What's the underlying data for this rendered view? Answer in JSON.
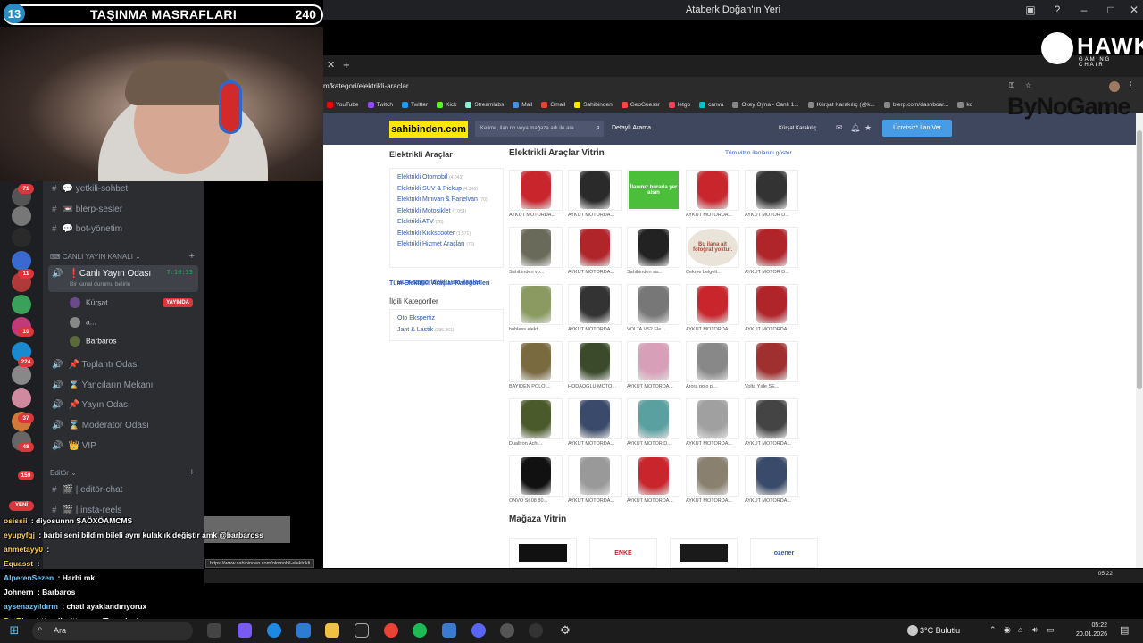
{
  "stream": {
    "left_count": "13",
    "title": "TAŞINMA MASRAFLARI",
    "right_count": "240"
  },
  "window": {
    "title": "Ataberk Doğan'ın Yeri"
  },
  "browser": {
    "url": "m/kategori/elektrikli-araclar",
    "bookmarks": [
      "YouTube",
      "Twitch",
      "Twitter",
      "Kick",
      "Streamlabs",
      "Mail",
      "Gmail",
      "Sahibinden",
      "GeoGuessr",
      "letgo",
      "canva",
      "Okey Oyna - Canlı 1...",
      "Kürşat Karakılıç (@k...",
      "blerp.com/dashboar...",
      "ko"
    ],
    "hover_link": "https://www.sahibinden.com/otomobil-elektrikli"
  },
  "overlay": {
    "hawk": "HAWK",
    "hawk_sub": "GAMING CHAIR",
    "bynogame": "ByNoGame"
  },
  "site": {
    "logo": "sahibinden.com",
    "search_placeholder": "Kelime, ilan no veya mağaza adı ile ara",
    "detailed_search": "Detaylı Arama",
    "user": "Kürşat Karakılıç",
    "post_ad": "Ücretsiz* İlan Ver",
    "left_title": "Elektrikli Araçlar",
    "categories": [
      {
        "name": "Elektrikli Otomobil",
        "count": "(4.043)"
      },
      {
        "name": "Elektrikli SUV & Pickup",
        "count": "(4.346)"
      },
      {
        "name": "Elektrikli Minivan & Panelvan",
        "count": "(70)"
      },
      {
        "name": "Elektrikli Motosiklet",
        "count": "(7.054)"
      },
      {
        "name": "Elektrikli ATV",
        "count": "(26)"
      },
      {
        "name": "Elektrikli Kickscooter",
        "count": "(1.571)"
      },
      {
        "name": "Elektrikli Hizmet Araçları",
        "count": "(76)"
      }
    ],
    "all_in_category": "Bu Kategorideki Tüm İlanlar",
    "all_categories": "Tüm Elektrikli Araçlar Kategorileri",
    "related_title": "İlgili Kategoriler",
    "related": [
      {
        "name": "Oto Ekspertiz",
        "count": ""
      },
      {
        "name": "Jant & Lastik",
        "count": "(395.361)"
      }
    ],
    "vitrin_title": "Elektrikli Araçlar Vitrin",
    "vitrin_all": "Tüm vitrin ilanlarını göster",
    "listings": [
      {
        "caption": "AYKUT MOTORDA...",
        "color": "#c8262c"
      },
      {
        "caption": "AYKUT MOTORDA...",
        "color": "#2a2a2a"
      },
      {
        "caption": "",
        "color": "#4bbf3a",
        "text": "İlanınız burada yer alsın"
      },
      {
        "caption": "AYKUT MOTORDA...",
        "color": "#c8262c"
      },
      {
        "caption": "AYKUT MOTOR D...",
        "color": "#333"
      },
      {
        "caption": "Sahibinden vo...",
        "color": "#6a6a5a"
      },
      {
        "caption": "AYKUT MOTORDA...",
        "color": "#b0252a"
      },
      {
        "caption": "Sahibinden sa...",
        "color": "#222"
      },
      {
        "caption": "Çekme belgeli...",
        "color": "#e9e3d9",
        "text": "Bu ilana ait fotoğraf yoktur."
      },
      {
        "caption": "AYKUT MOTOR D...",
        "color": "#b0252a"
      },
      {
        "caption": "hubless elekt...",
        "color": "#8a9a60"
      },
      {
        "caption": "AYKUT MOTORDA...",
        "color": "#333"
      },
      {
        "caption": "VOLTA VS2 Ele...",
        "color": "#777"
      },
      {
        "caption": "AYKUT MOTORDA...",
        "color": "#c8262c"
      },
      {
        "caption": "AYKUT MOTORDA...",
        "color": "#b0252a"
      },
      {
        "caption": "BAYİDEN POLO ...",
        "color": "#7a6a40"
      },
      {
        "caption": "HODAOĞLU MOTO...",
        "color": "#3a4a2a"
      },
      {
        "caption": "AYKUT MOTORDA...",
        "color": "#d8a0b8"
      },
      {
        "caption": "Arora polo pl...",
        "color": "#888"
      },
      {
        "caption": "Volta Yıde SE...",
        "color": "#a03030"
      },
      {
        "caption": "Dualtron Achi...",
        "color": "#4a5a2a"
      },
      {
        "caption": "AYKUT MOTORDA...",
        "color": "#3a4a6a"
      },
      {
        "caption": "AYKUT MOTOR D...",
        "color": "#5aa0a0"
      },
      {
        "caption": "AYKUT MOTORDA...",
        "color": "#a0a0a0"
      },
      {
        "caption": "AYKUT MOTORDA...",
        "color": "#444"
      },
      {
        "caption": "ONVO St-08 80...",
        "color": "#111"
      },
      {
        "caption": "AYKUT MOTORDA...",
        "color": "#999"
      },
      {
        "caption": "AYKUT MOTORDA...",
        "color": "#c8262c"
      },
      {
        "caption": "AYKUT MOTORDA...",
        "color": "#8a8070"
      },
      {
        "caption": "AYKUT MOTORDA...",
        "color": "#3a4a6a"
      }
    ],
    "store_title": "Mağaza Vitrin",
    "stores": [
      "",
      "ENKE",
      "",
      "ozener"
    ]
  },
  "discord": {
    "guild_badges": [
      "71",
      "11",
      "10",
      "224",
      "37",
      "48",
      "159"
    ],
    "new_label": "YENİ",
    "channels": {
      "c1": "yetkili-sohbet",
      "c2": "blerp-sesler",
      "c3": "bot-yönetim",
      "voice_category": "CANLI YAYIN KANALI",
      "active": "Canlı Yayın Odası",
      "timer": "7:10:33",
      "status": "Bir kanal durumu belirle",
      "users": [
        "Kürşat",
        "a...",
        "Barbaros"
      ],
      "live": "YAYINDA",
      "v2": "Toplantı Odası",
      "v3": "Yancıların Mekanı",
      "v4": "Yayın Odası",
      "v5": "Moderatör Odası",
      "v6": "VIP",
      "editor_category": "Editör",
      "e1": "editör-chat",
      "e2": "insta-reels"
    }
  },
  "chat": [
    {
      "name": "osissii",
      "msg": "diyosunnn ŞAÖXÖAMCMS",
      "color": "#ffd24a"
    },
    {
      "name": "eyupyfgj",
      "msg": "barbi seni bildim bileli aynı kulaklık değiştir amk @barbaross",
      "color": "#ffd24a"
    },
    {
      "name": "ahmetayy0",
      "msg": "",
      "color": "#ffd24a"
    },
    {
      "name": "Equasst",
      "msg": "",
      "color": "#ffd24a"
    },
    {
      "name": "AlperenSezen",
      "msg": "Harbi mk",
      "color": "#6ecbff"
    },
    {
      "name": "Johnern",
      "msg": "Barbaros",
      "color": "#ffffff"
    },
    {
      "name": "aysenazyıldırm",
      "msg": "chatl ayaklandırıyorux",
      "color": "#6ecbff"
    },
    {
      "name": "BotRix",
      "msg": "https://twitter.com/Prenshydronn",
      "color": "#ffd24a"
    }
  ],
  "taskbar": {
    "search": "Ara",
    "weather": "3°C  Bulutlu",
    "time": "05:22",
    "date": "20.01.2026",
    "strip_time": "05:22"
  }
}
